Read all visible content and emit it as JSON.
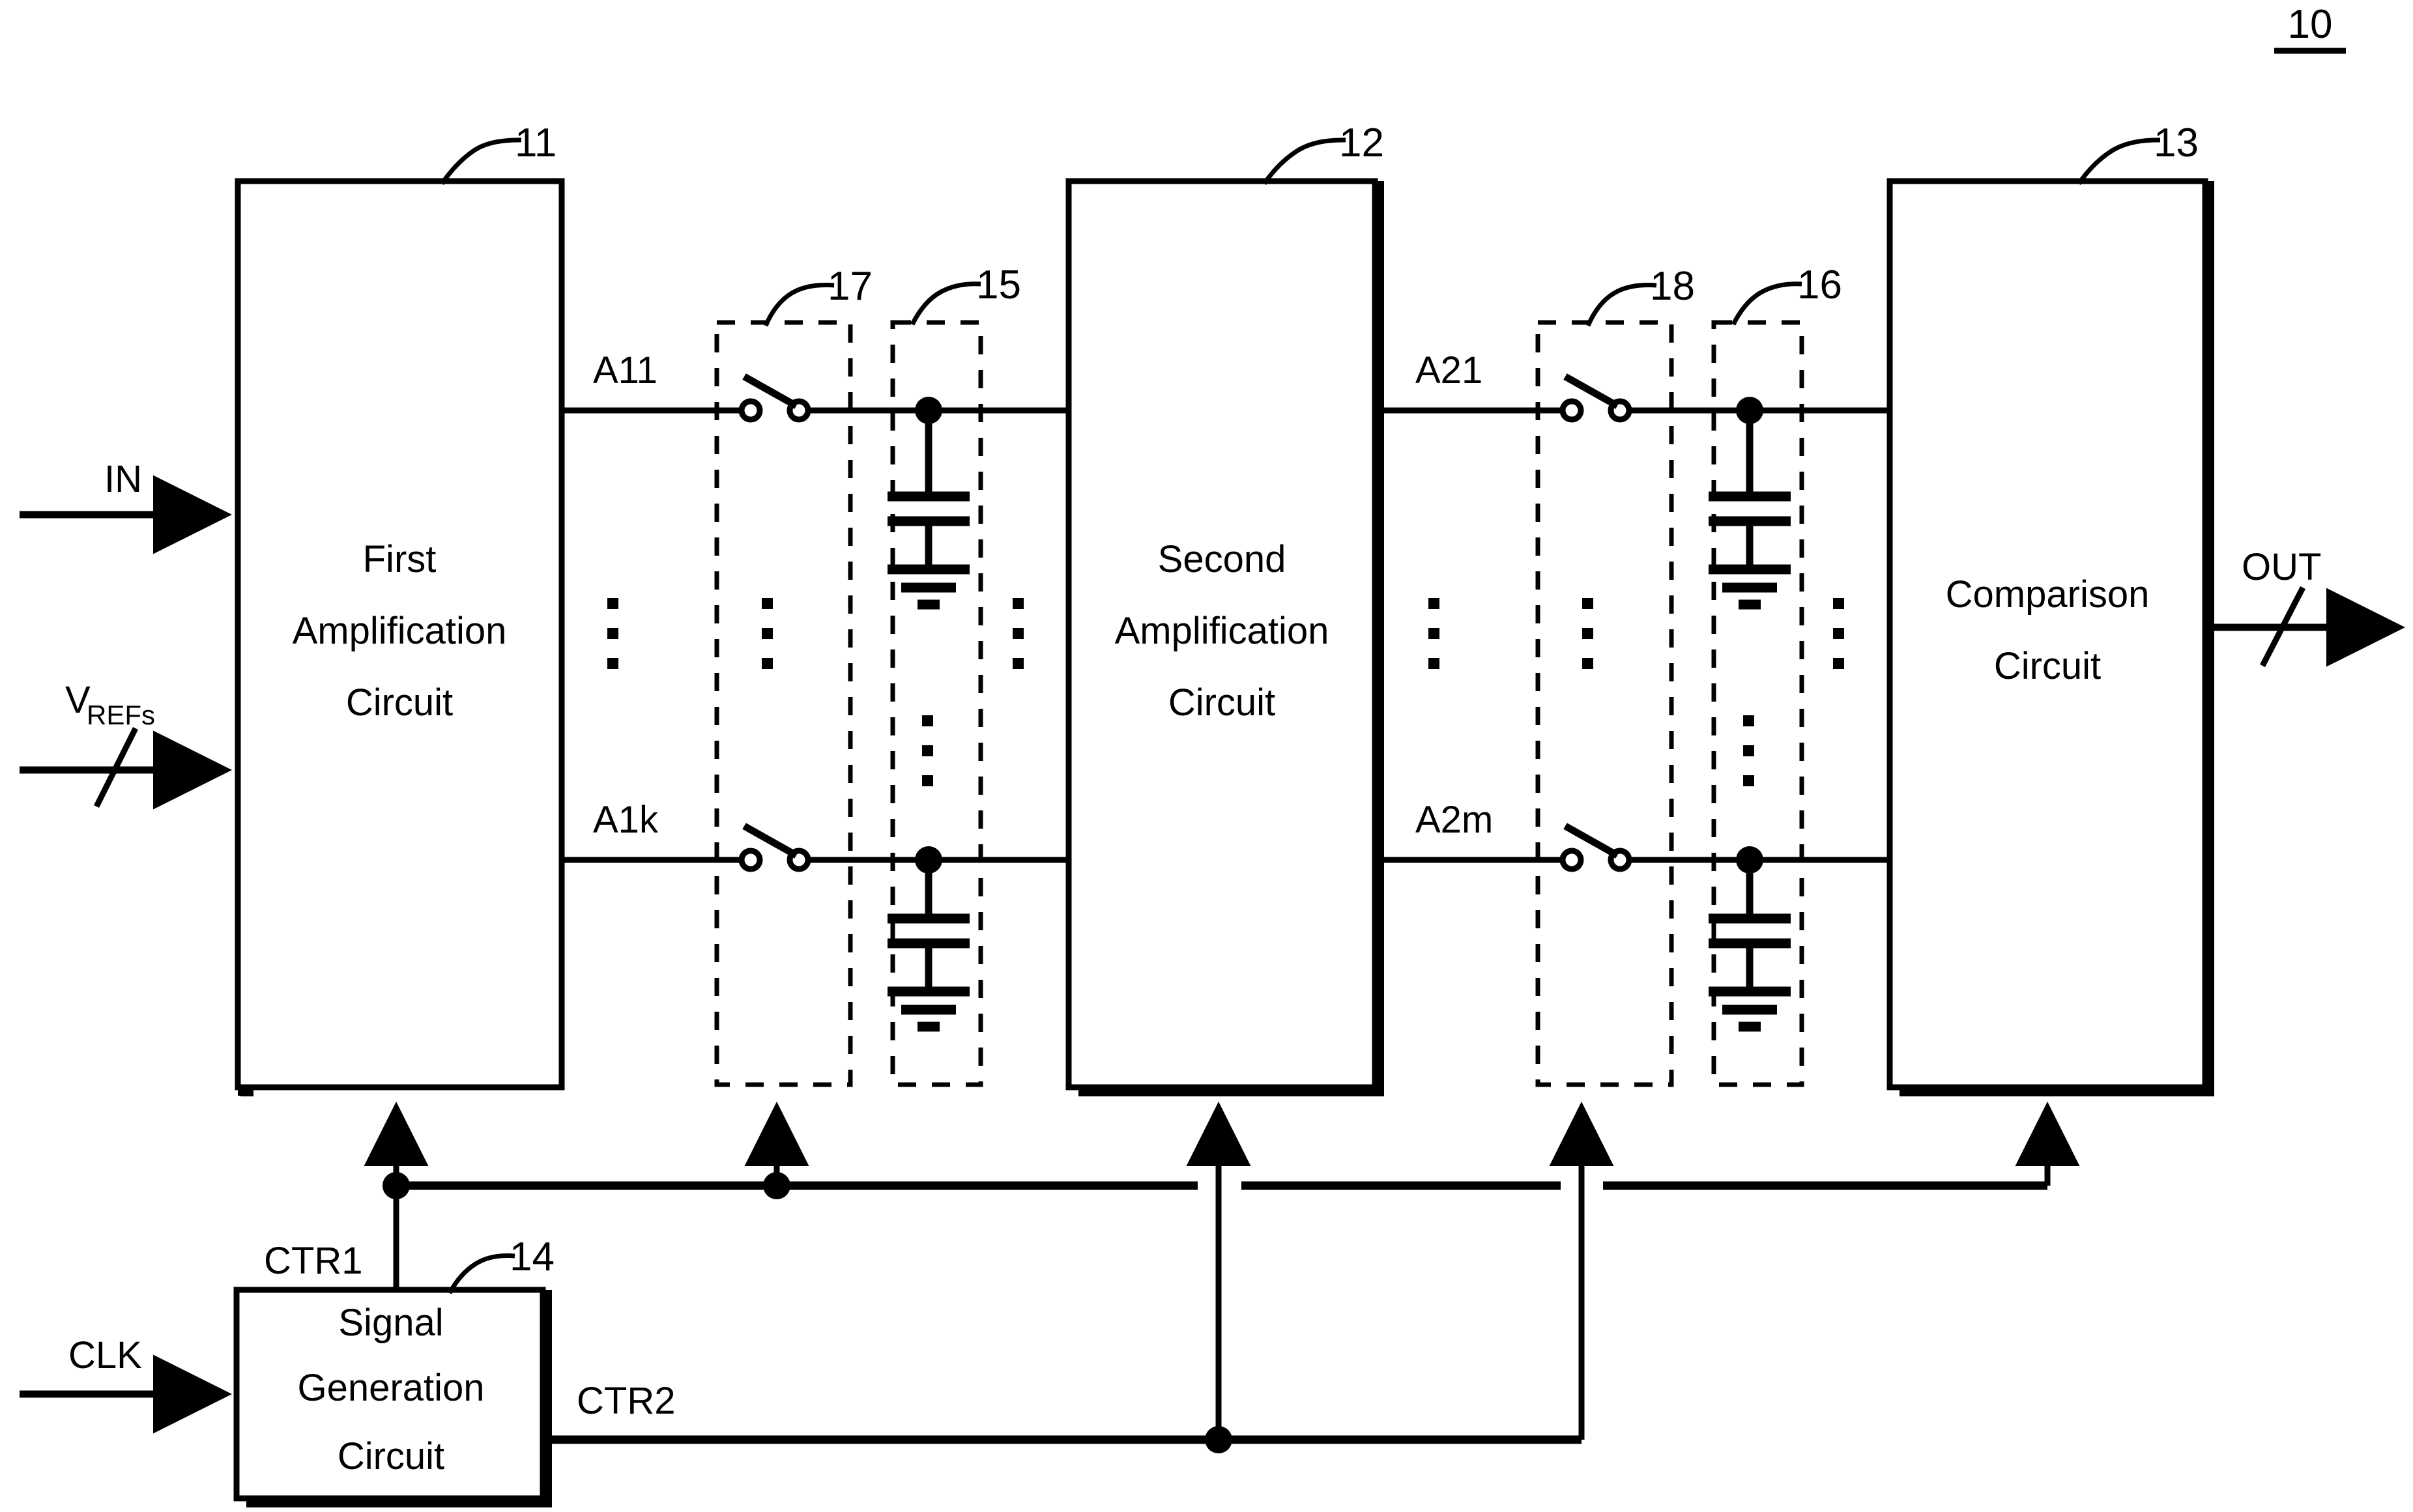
{
  "figure": {
    "number": "10",
    "type": "patent-block-diagram"
  },
  "blocks": [
    {
      "id": "first-amp",
      "ref": "11",
      "line1": "First",
      "line2": "Amplification",
      "line3": "Circuit"
    },
    {
      "id": "second-amp",
      "ref": "12",
      "line1": "Second",
      "line2": "Amplification",
      "line3": "Circuit"
    },
    {
      "id": "comparison",
      "ref": "13",
      "line1": "Comparison",
      "line2": "Circuit",
      "line3": ""
    },
    {
      "id": "signal-gen",
      "ref": "14",
      "line1": "Signal",
      "line2": "Generation",
      "line3": "Circuit"
    }
  ],
  "dashed_groups": [
    {
      "id": "switch-group-1",
      "ref": "17"
    },
    {
      "id": "capacitor-group-1",
      "ref": "15"
    },
    {
      "id": "switch-group-2",
      "ref": "18"
    },
    {
      "id": "capacitor-group-2",
      "ref": "16"
    }
  ],
  "signals": {
    "input": "IN",
    "reference_base": "V",
    "reference_sub": "REFs",
    "clock": "CLK",
    "output": "OUT",
    "amp1_top": "A11",
    "amp1_bottom": "A1k",
    "amp2_top": "A21",
    "amp2_bottom": "A2m",
    "control1": "CTR1",
    "control2": "CTR2"
  },
  "icons": {
    "switch": "open-switch-icon",
    "capacitor": "capacitor-icon",
    "ground": "ground-icon",
    "ellipsis": "vertical-ellipsis-icon",
    "arrow": "arrow-head-icon",
    "bus-slash": "bus-slash-icon",
    "junction": "junction-dot-icon"
  },
  "colors": {
    "stroke": "#000000",
    "fill": "#ffffff"
  }
}
